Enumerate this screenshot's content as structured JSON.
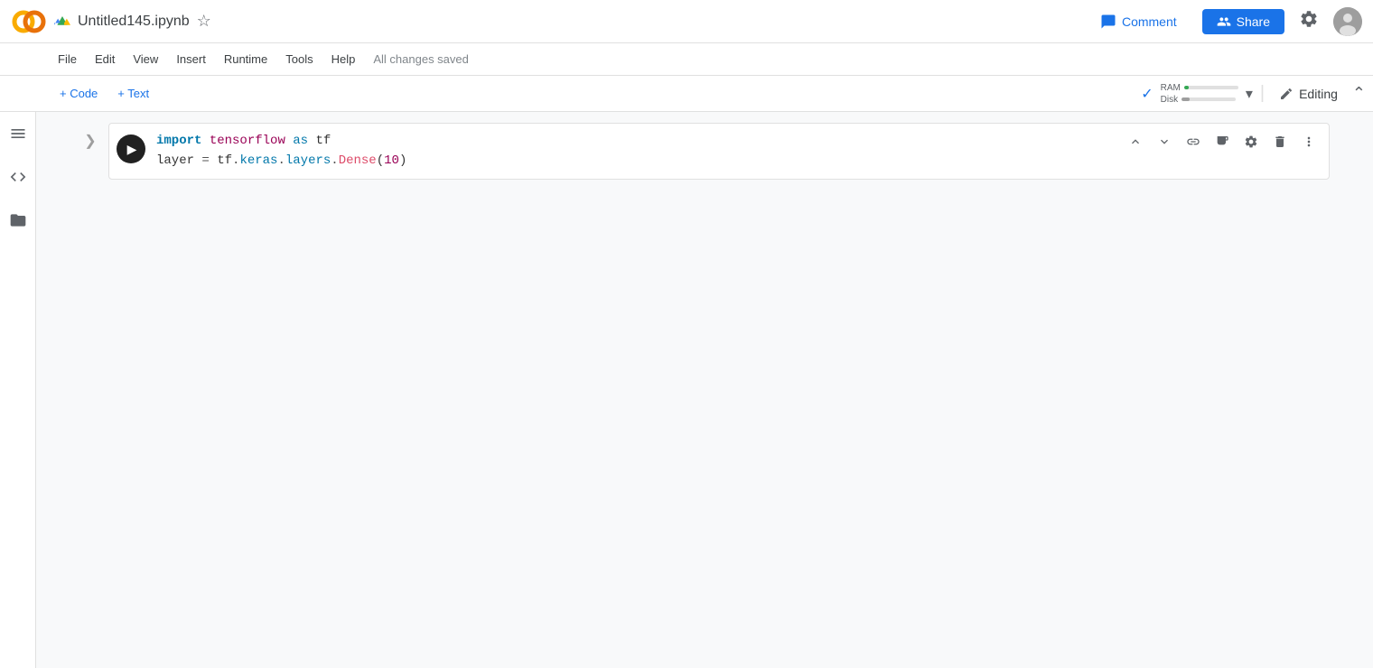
{
  "app": {
    "logo_text": "CO",
    "title": "Untitled145.ipynb",
    "save_status": "All changes saved"
  },
  "header": {
    "comment_label": "Comment",
    "share_label": "Share"
  },
  "menu": {
    "items": [
      "File",
      "Edit",
      "View",
      "Insert",
      "Runtime",
      "Tools",
      "Help"
    ]
  },
  "toolbar": {
    "add_code_label": "+ Code",
    "add_text_label": "+ Text",
    "ram_label": "RAM",
    "disk_label": "Disk",
    "ram_percent": 8,
    "disk_percent": 15,
    "editing_label": "Editing"
  },
  "sidebar": {
    "icons": [
      "menu",
      "code",
      "folder"
    ]
  },
  "cell": {
    "run_title": "Run cell",
    "code_line1": "import tensorflow as tf",
    "code_line2": "layer = tf.keras.layers.Dense(10)",
    "toolbar_buttons": [
      "move-up",
      "move-down",
      "link",
      "code-view",
      "settings",
      "delete",
      "more"
    ]
  }
}
